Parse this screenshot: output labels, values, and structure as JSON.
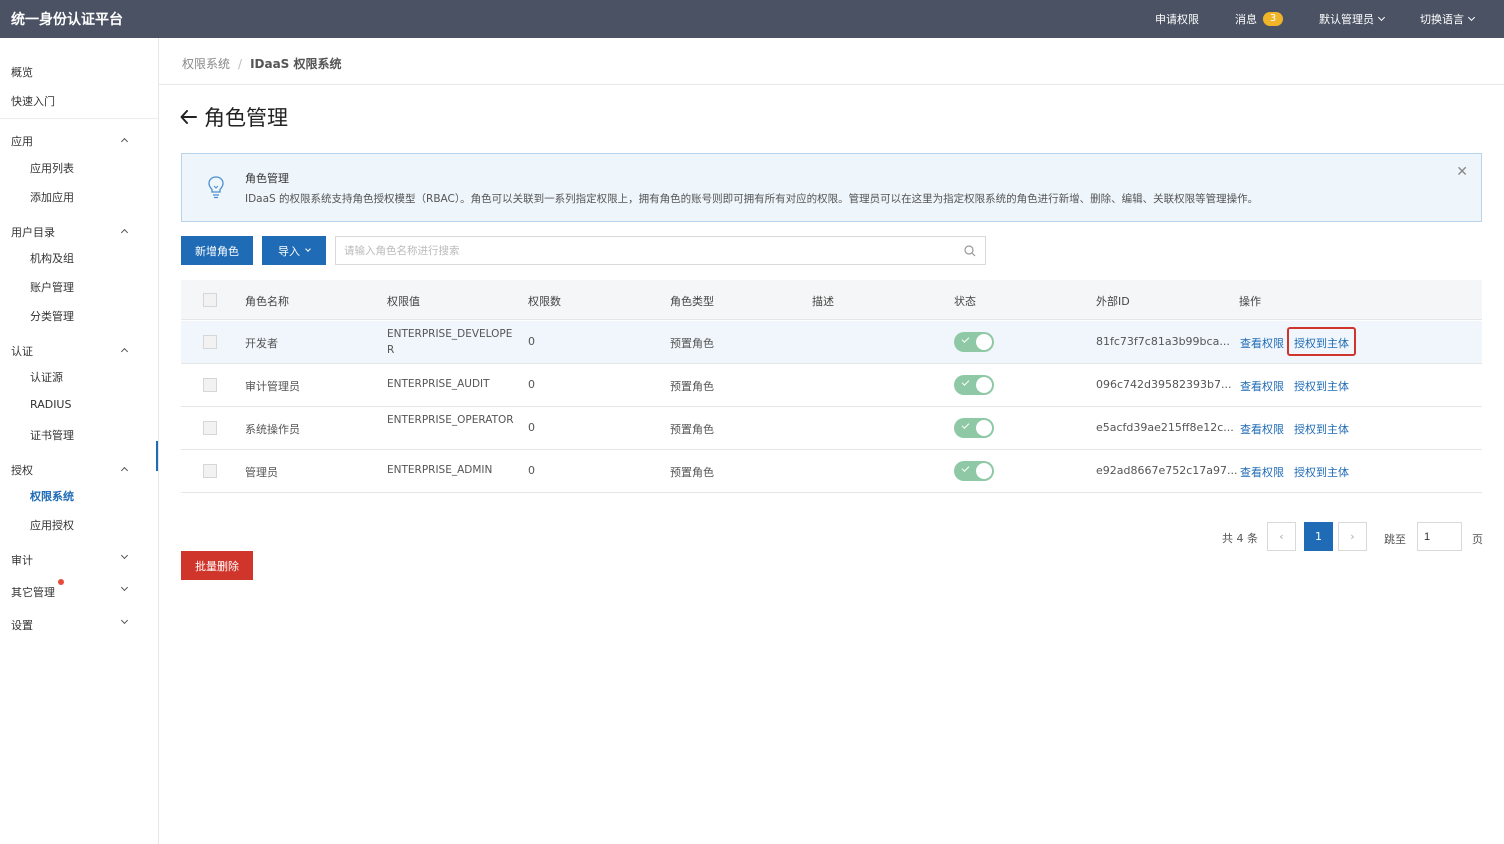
{
  "topbar": {
    "brand": "统一身份认证平台",
    "apply_permission": "申请权限",
    "messages": "消息",
    "message_count": "3",
    "user": "默认管理员",
    "language": "切换语言"
  },
  "sidebar": {
    "overview": "概览",
    "quickstart": "快速入门",
    "apps": "应用",
    "app_list": "应用列表",
    "add_app": "添加应用",
    "directory": "用户目录",
    "org": "机构及组",
    "accounts": "账户管理",
    "categories": "分类管理",
    "auth": "认证",
    "auth_source": "认证源",
    "radius": "RADIUS",
    "certs": "证书管理",
    "authorization": "授权",
    "perm_system": "权限系统",
    "app_auth": "应用授权",
    "audit": "审计",
    "other": "其它管理",
    "settings": "设置"
  },
  "breadcrumb": {
    "parent": "权限系统",
    "current": "IDaaS 权限系统"
  },
  "page": {
    "title": "角色管理"
  },
  "notice": {
    "title": "角色管理",
    "text": "IDaaS 的权限系统支持角色授权模型（RBAC）。角色可以关联到一系列指定权限上，拥有角色的账号则即可拥有所有对应的权限。管理员可以在这里为指定权限系统的角色进行新增、删除、编辑、关联权限等管理操作。"
  },
  "toolbar": {
    "add_role": "新增角色",
    "import": "导入",
    "search_placeholder": "请输入角色名称进行搜索",
    "batch_delete": "批量删除"
  },
  "table": {
    "headers": [
      "角色名称",
      "权限值",
      "权限数",
      "角色类型",
      "描述",
      "状态",
      "外部ID",
      "操作"
    ],
    "rows": [
      {
        "name": "开发者",
        "value": "ENTERPRISE_DEVELOPER",
        "count": "0",
        "type": "预置角色",
        "desc": "",
        "external_id": "81fc73f7c81a3b99bca...",
        "view": "查看权限",
        "grant": "授权到主体"
      },
      {
        "name": "审计管理员",
        "value": "ENTERPRISE_AUDIT",
        "count": "0",
        "type": "预置角色",
        "desc": "",
        "external_id": "096c742d39582393b7...",
        "view": "查看权限",
        "grant": "授权到主体"
      },
      {
        "name": "系统操作员",
        "value": "ENTERPRISE_OPERATOR",
        "count": "0",
        "type": "预置角色",
        "desc": "",
        "external_id": "e5acfd39ae215ff8e12c...",
        "view": "查看权限",
        "grant": "授权到主体"
      },
      {
        "name": "管理员",
        "value": "ENTERPRISE_ADMIN",
        "count": "0",
        "type": "预置角色",
        "desc": "",
        "external_id": "e92ad8667e752c17a97...",
        "view": "查看权限",
        "grant": "授权到主体"
      }
    ]
  },
  "pagination": {
    "total": "共 4 条",
    "prev": "‹",
    "current_page": "1",
    "next": "›",
    "goto_label": "跳至",
    "goto_value": "1",
    "page_unit": "页"
  },
  "colors": {
    "primary": "#1f6bb5",
    "danger": "#d0352b",
    "topbar": "#4a5263",
    "toggle_on": "#8fc8a4"
  }
}
